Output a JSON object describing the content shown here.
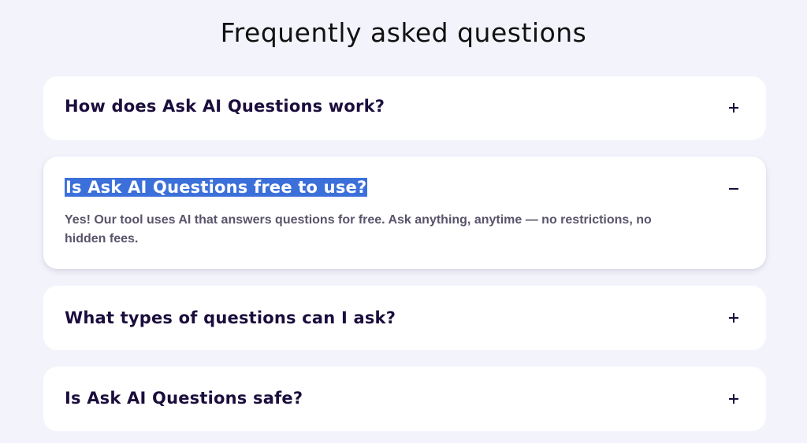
{
  "faq": {
    "title": "Frequently asked questions",
    "items": [
      {
        "question": "How does Ask AI Questions work?",
        "expanded": false,
        "toggle_icon": "plus-icon"
      },
      {
        "question": "Is Ask AI Questions free to use?",
        "expanded": true,
        "toggle_icon": "minus-icon",
        "answer": "Yes! Our tool uses AI that answers questions for free. Ask anything, anytime — no restrictions, no hidden fees."
      },
      {
        "question": "What types of questions can I ask?",
        "expanded": false,
        "toggle_icon": "plus-icon"
      },
      {
        "question": "Is Ask AI Questions safe?",
        "expanded": false,
        "toggle_icon": "plus-icon"
      }
    ]
  },
  "colors": {
    "page_background": "#f3f3fc",
    "card_background": "#ffffff",
    "heading_text": "#1b0e3d",
    "answer_text": "#5a546b",
    "selection_highlight": "#3b6fd9"
  }
}
